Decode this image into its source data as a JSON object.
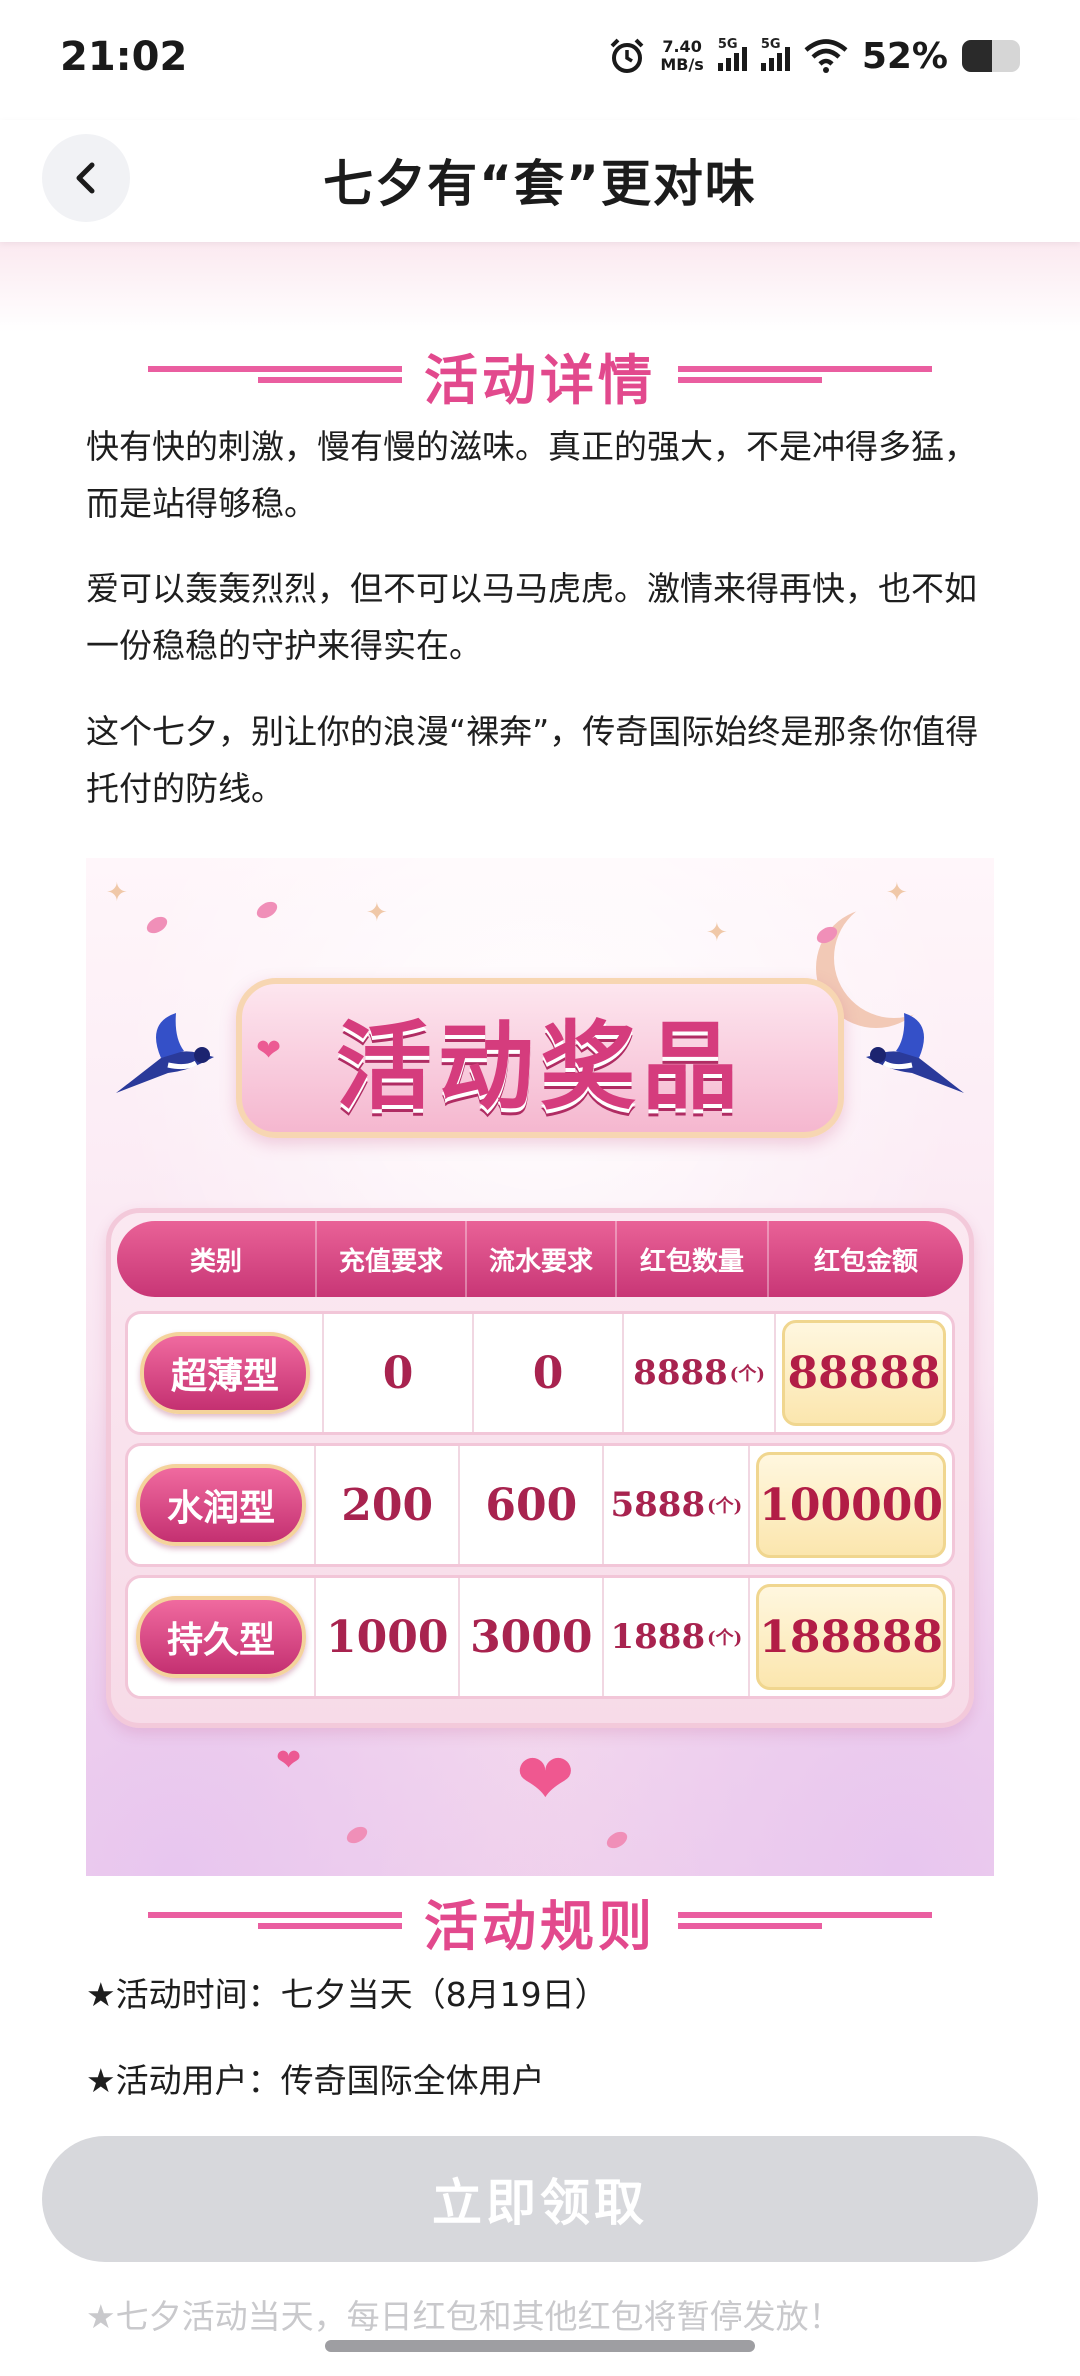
{
  "status_bar": {
    "time": "21:02",
    "speed_value": "7.40",
    "speed_unit": "MB/s",
    "signal1_label": "5G",
    "signal2_label": "5G",
    "battery_text": "52%",
    "battery_level_percent": 52
  },
  "header": {
    "title": "七夕有“套”更对味"
  },
  "section_details": {
    "title": "活动详情",
    "paragraphs": [
      "快有快的刺激，慢有慢的滋味。真正的强大，不是冲得多猛，而是站得够稳。",
      "爱可以轰轰烈烈，但不可以马马虎虎。激情来得再快，也不如一份稳稳的守护来得实在。",
      "这个七夕，别让你的浪漫“裸奔”，传奇国际始终是那条你值得托付的防线。"
    ]
  },
  "prize_banner": {
    "title": "活动奖品",
    "columns": [
      "类别",
      "充值要求",
      "流水要求",
      "红包数量",
      "红包金额"
    ],
    "count_unit": "(个)",
    "rows": [
      {
        "type": "超薄型",
        "recharge": "0",
        "turnover": "0",
        "count": "8888",
        "amount": "88888"
      },
      {
        "type": "水润型",
        "recharge": "200",
        "turnover": "600",
        "count": "5888",
        "amount": "100000"
      },
      {
        "type": "持久型",
        "recharge": "1000",
        "turnover": "3000",
        "count": "1888",
        "amount": "188888"
      }
    ]
  },
  "section_rules": {
    "title": "活动规则",
    "items": [
      "★活动时间：七夕当天（8月19日）",
      "★活动用户：传奇国际全体用户"
    ],
    "faded_item": "★七夕活动当天，每日红包和其他红包将暂停发放！"
  },
  "claim_button": {
    "label": "立即领取"
  },
  "colors": {
    "accent_pink": "#e2498d",
    "button_disabled": "#d7d8dc",
    "amount_red": "#b21d46"
  }
}
